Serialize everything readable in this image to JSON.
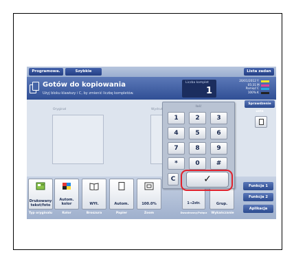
{
  "tabs": [
    {
      "label": "Programowa."
    },
    {
      "label": "Szybkie kopiowani"
    },
    {
      "label": "Lista zadan"
    }
  ],
  "header": {
    "title": "Gotów do kopiowania",
    "subtitle": "Użyj bloku klawiszy i C, by zmienić liczbę kompletów.",
    "count_label": "Liczba komplet",
    "count_value": "1",
    "date": "20/01/2012",
    "time": "05:31",
    "memory_label": "Pamięć",
    "memory_value": "100%"
  },
  "toner": [
    {
      "letter": "Y",
      "color": "#f2e62a"
    },
    {
      "letter": "M",
      "color": "#e0429a"
    },
    {
      "letter": "C",
      "color": "#2aa7e0"
    },
    {
      "letter": "K",
      "color": "#222222"
    }
  ],
  "right_panel": {
    "check_job": "Sprawdzenie usta",
    "function1": "Funkcja 1",
    "function2": "Funkcja 2",
    "apply": "Aplikacja"
  },
  "preview": {
    "original_label": "Oryginał",
    "output_label": "Wydruk"
  },
  "keypad": {
    "label": "Ilość",
    "keys": [
      "1",
      "2",
      "3",
      "4",
      "5",
      "6",
      "7",
      "8",
      "9",
      "*",
      "0",
      "#"
    ],
    "clear": "C",
    "ok": "✓"
  },
  "function_buttons": [
    {
      "label": "Drukowany tekst/foto"
    },
    {
      "label": "Autom. kolor"
    },
    {
      "label": "WYł."
    },
    {
      "label": "Autom."
    },
    {
      "label": "100.0%"
    },
    {
      "label": "1→2str."
    },
    {
      "label": "Grup."
    }
  ],
  "categories": [
    {
      "label": "Typ oryginalu"
    },
    {
      "label": "Kolor"
    },
    {
      "label": "Broszura"
    },
    {
      "label": "Papier"
    },
    {
      "label": "Zoom"
    },
    {
      "label": "Dwustronny/Połącz"
    },
    {
      "label": "Wykańczanie"
    }
  ]
}
